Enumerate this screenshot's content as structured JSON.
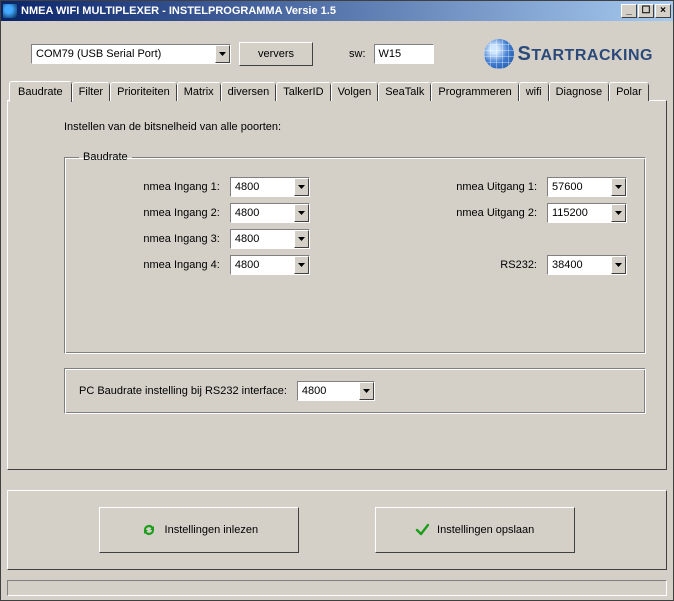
{
  "title": "NMEA WIFI MULTIPLEXER - INSTELPROGRAMMA Versie 1.5",
  "toolbar": {
    "port": "COM79 (USB Serial Port)",
    "ververs": "ververs",
    "sw_label": "sw:",
    "sw_value": "W15",
    "brand_big": "S",
    "brand_rest": "TARTRACKING"
  },
  "tabs": [
    "Baudrate",
    "Filter",
    "Prioriteiten",
    "Matrix",
    "diversen",
    "TalkerID",
    "Volgen",
    "SeaTalk",
    "Programmeren",
    "wifi",
    "Diagnose",
    "Polar"
  ],
  "active_tab_index": 0,
  "intro": "Instellen van de bitsnelheid van alle poorten:",
  "group_title": "Baudrate",
  "labels": {
    "ingang1": "nmea Ingang 1:",
    "ingang2": "nmea Ingang 2:",
    "ingang3": "nmea Ingang 3:",
    "ingang4": "nmea Ingang 4:",
    "uitgang1": "nmea Uitgang 1:",
    "uitgang2": "nmea Uitgang 2:",
    "rs232": "RS232:",
    "pc_label": "PC Baudrate instelling bij RS232 interface:"
  },
  "values": {
    "ingang1": "4800",
    "ingang2": "4800",
    "ingang3": "4800",
    "ingang4": "4800",
    "uitgang1": "57600",
    "uitgang2": "115200",
    "rs232": "38400",
    "pc": "4800"
  },
  "buttons": {
    "inlezen": "Instellingen inlezen",
    "opslaan": "Instellingen opslaan"
  }
}
